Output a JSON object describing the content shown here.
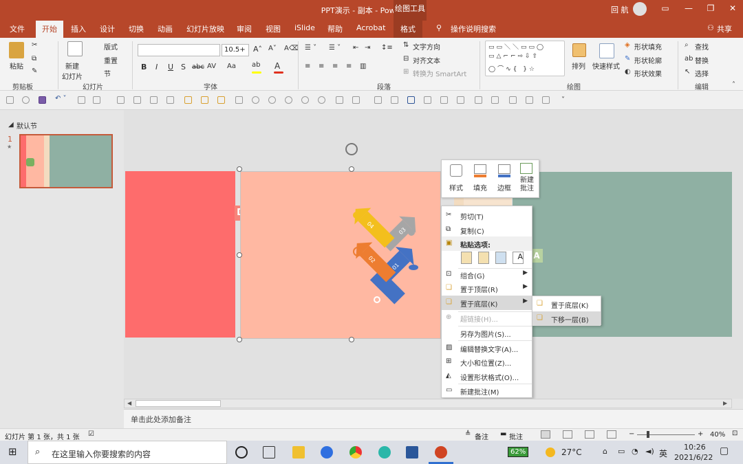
{
  "window": {
    "title": "PPT演示 - 副本  -  PowerPoint",
    "context_tools": "绘图工具",
    "user": "回 航",
    "share": "共享"
  },
  "tabs": [
    "文件",
    "开始",
    "插入",
    "设计",
    "切换",
    "动画",
    "幻灯片放映",
    "审阅",
    "视图",
    "iSlide",
    "帮助",
    "Acrobat",
    "格式"
  ],
  "active_tab": "开始",
  "tell_me": "操作说明搜索",
  "ribbon": {
    "clipboard": {
      "label": "剪贴板",
      "paste": "粘贴"
    },
    "slides": {
      "label": "幻灯片",
      "new_slide": "新建\n幻灯片",
      "layout": "版式",
      "reset": "重置",
      "section": "节"
    },
    "font": {
      "label": "字体",
      "font_name": "",
      "font_size": "10.5+"
    },
    "paragraph": {
      "label": "段落",
      "text_direction": "文字方向",
      "align_text": "对齐文本",
      "smartart": "转换为 SmartArt"
    },
    "drawing": {
      "label": "绘图",
      "arrange": "排列",
      "quick_styles": "快速样式",
      "shape_fill": "形状填充",
      "shape_outline": "形状轮廓",
      "shape_effects": "形状效果"
    },
    "editing": {
      "label": "编辑",
      "find": "查找",
      "replace": "替换",
      "select": "选择"
    }
  },
  "slide_panel": {
    "section": "默认节",
    "slide_number": "1"
  },
  "mini_toolbar": {
    "items": [
      "样式",
      "填充",
      "边框",
      "新建\n批注"
    ]
  },
  "context_menu": {
    "items": [
      {
        "label": "剪切(T)",
        "icon": "scissors-icon"
      },
      {
        "label": "复制(C)",
        "icon": "copy-icon"
      },
      {
        "label": "粘贴选项:",
        "icon": "paste-icon"
      },
      {
        "label": "组合(G)",
        "icon": "group-icon",
        "submenu": true
      },
      {
        "label": "置于顶层(R)",
        "icon": "bring-front-icon",
        "submenu": true
      },
      {
        "label": "置于底层(K)",
        "icon": "send-back-icon",
        "submenu": true
      },
      {
        "label": "超链接(H)...",
        "icon": "link-icon",
        "disabled": true
      },
      {
        "label": "另存为图片(S)...",
        "icon": ""
      },
      {
        "label": "编辑替换文字(A)...",
        "icon": "alt-text-icon"
      },
      {
        "label": "大小和位置(Z)...",
        "icon": "size-icon"
      },
      {
        "label": "设置形状格式(O)...",
        "icon": "format-shape-icon"
      },
      {
        "label": "新建批注(M)",
        "icon": "comment-icon"
      }
    ]
  },
  "submenu": {
    "items": [
      "置于底层(K)",
      "下移一层(B)"
    ]
  },
  "notes_placeholder": "单击此处添加备注",
  "status": {
    "slide_info": "幻灯片 第 1 张，共 1 张",
    "notes": "备注",
    "comments": "批注",
    "zoom": "40%"
  },
  "taskbar": {
    "search_placeholder": "在这里输入你要搜索的内容",
    "battery": "62%",
    "temperature": "27°C",
    "ime": "英",
    "time": "10:26",
    "date": "2021/6/22"
  },
  "slide_content": {
    "arrows": [
      {
        "num": "04",
        "color": "#f3bf1d"
      },
      {
        "num": "03",
        "color": "#a6a6a6"
      },
      {
        "num": "02",
        "color": "#ed7d31"
      },
      {
        "num": "01",
        "color": "#4472c4"
      }
    ],
    "tag_d": "D",
    "tag_a": "A"
  }
}
